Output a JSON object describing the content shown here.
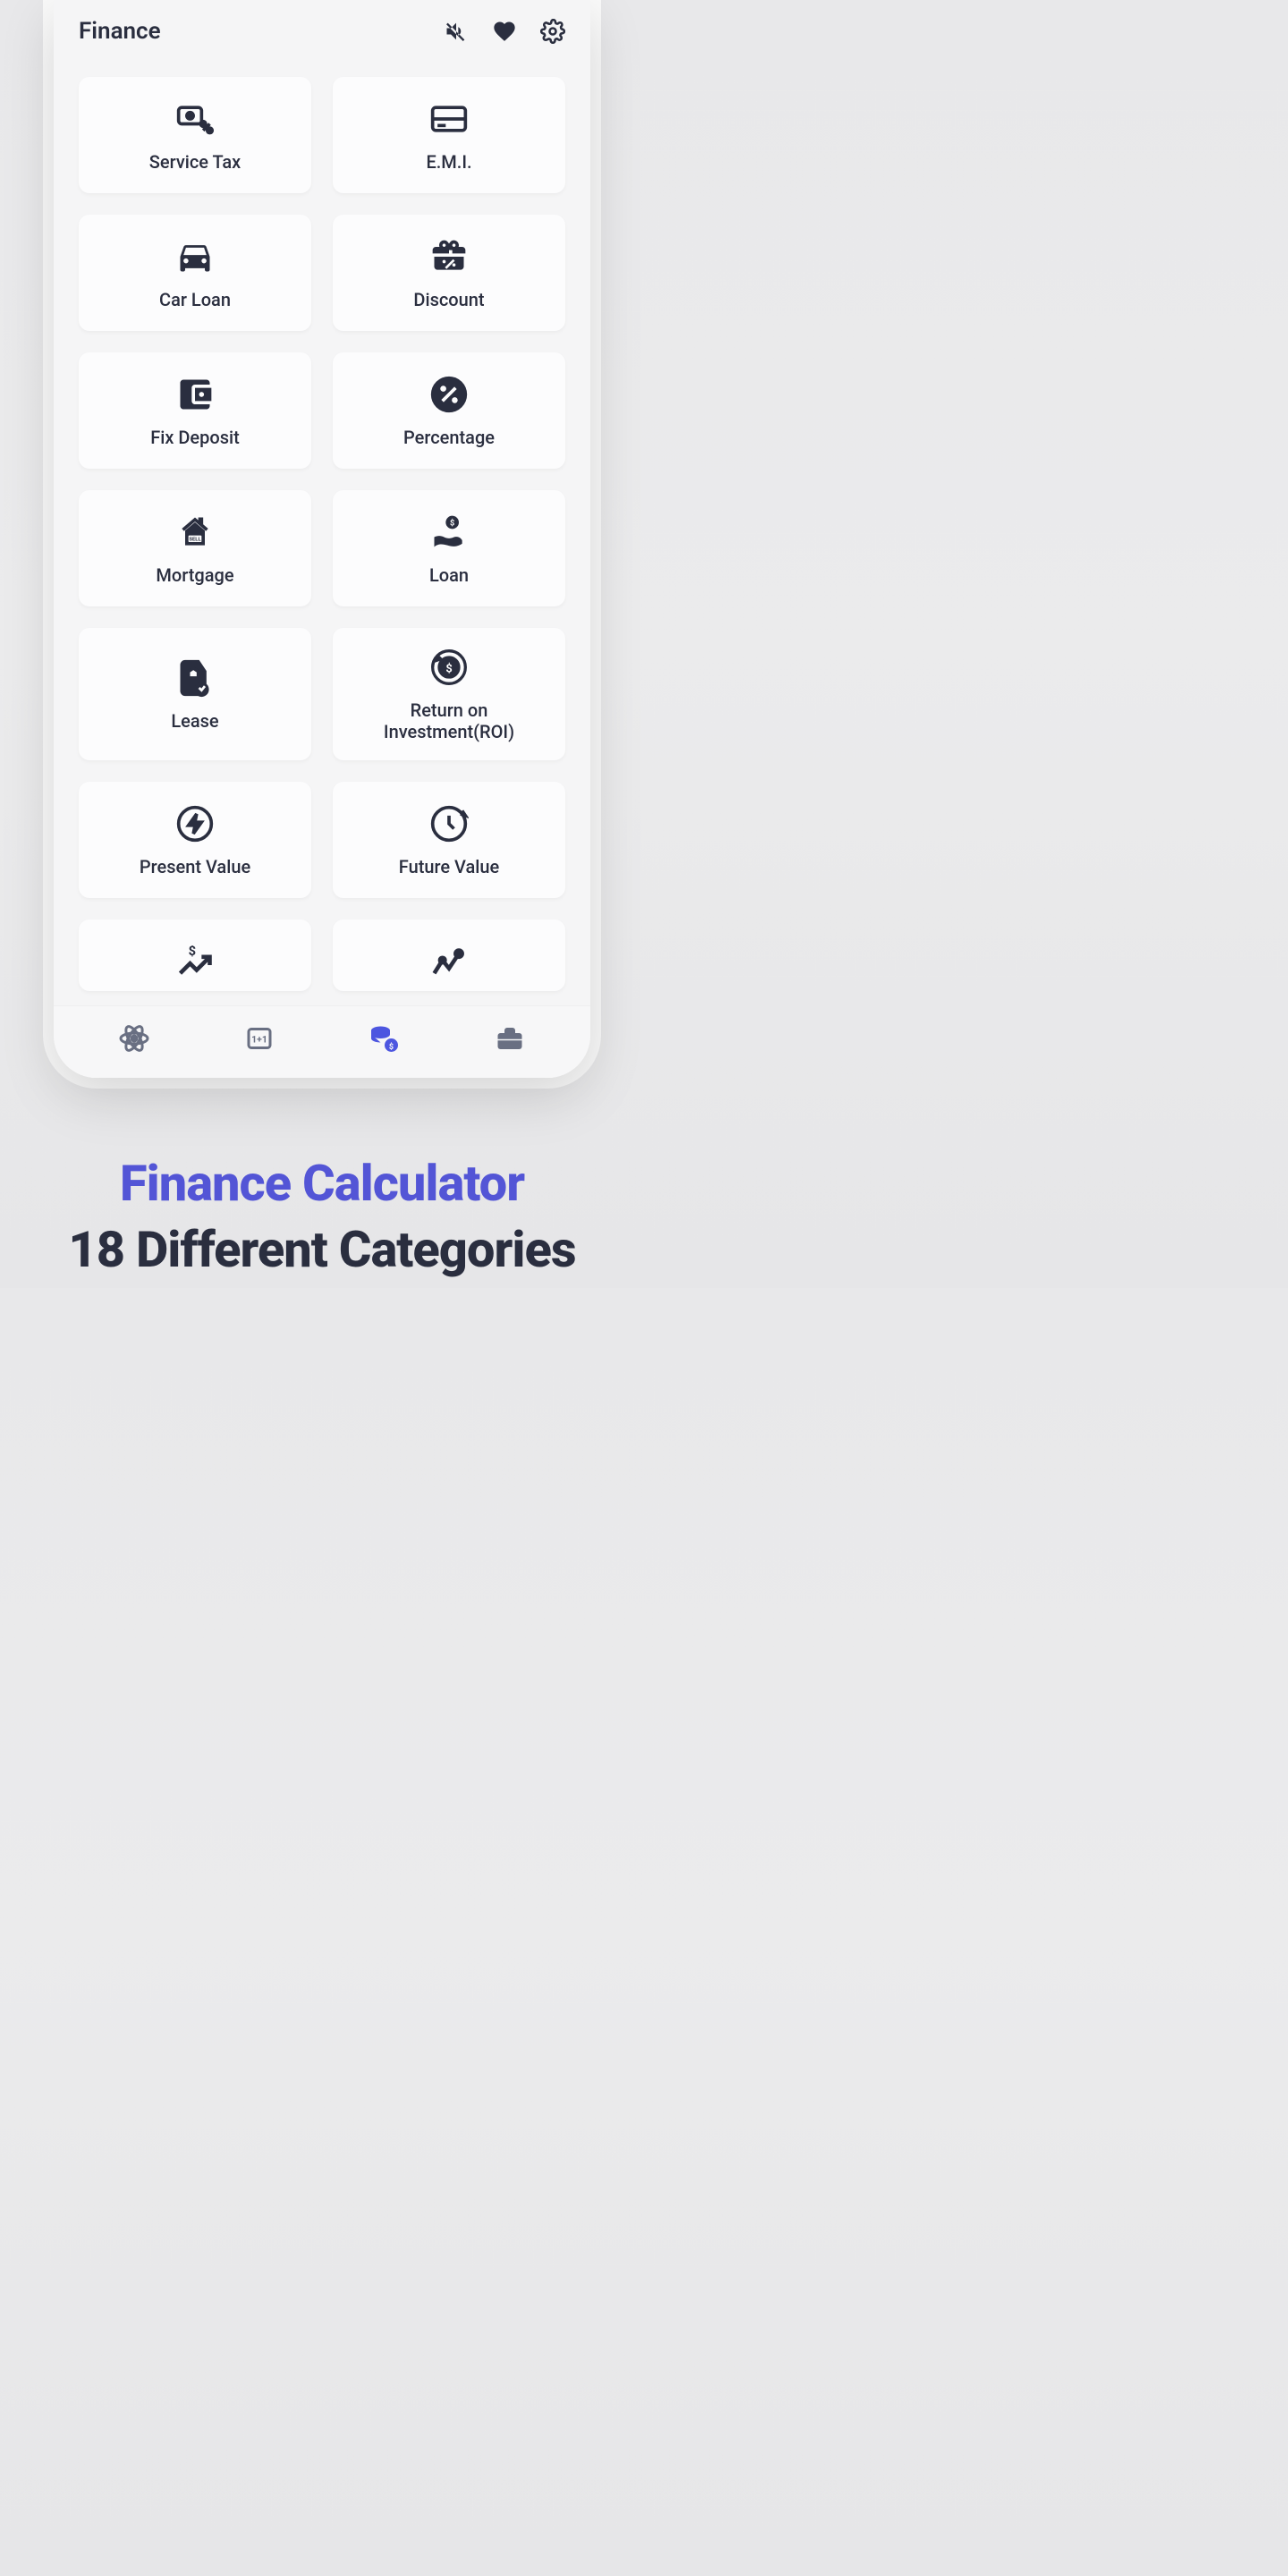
{
  "header": {
    "title": "Finance"
  },
  "cards": [
    {
      "label": "Service Tax",
      "icon": "service-tax"
    },
    {
      "label": "E.M.I.",
      "icon": "emi"
    },
    {
      "label": "Car Loan",
      "icon": "car"
    },
    {
      "label": "Discount",
      "icon": "discount"
    },
    {
      "label": "Fix Deposit",
      "icon": "wallet"
    },
    {
      "label": "Percentage",
      "icon": "percentage"
    },
    {
      "label": "Mortgage",
      "icon": "mortgage"
    },
    {
      "label": "Loan",
      "icon": "loan"
    },
    {
      "label": "Lease",
      "icon": "lease"
    },
    {
      "label": "Return on Investment(ROI)",
      "icon": "roi"
    },
    {
      "label": "Present Value",
      "icon": "present-value"
    },
    {
      "label": "Future Value",
      "icon": "future-value"
    }
  ],
  "promo": {
    "title": "Finance Calculator",
    "subtitle": "18 Different Categories"
  }
}
